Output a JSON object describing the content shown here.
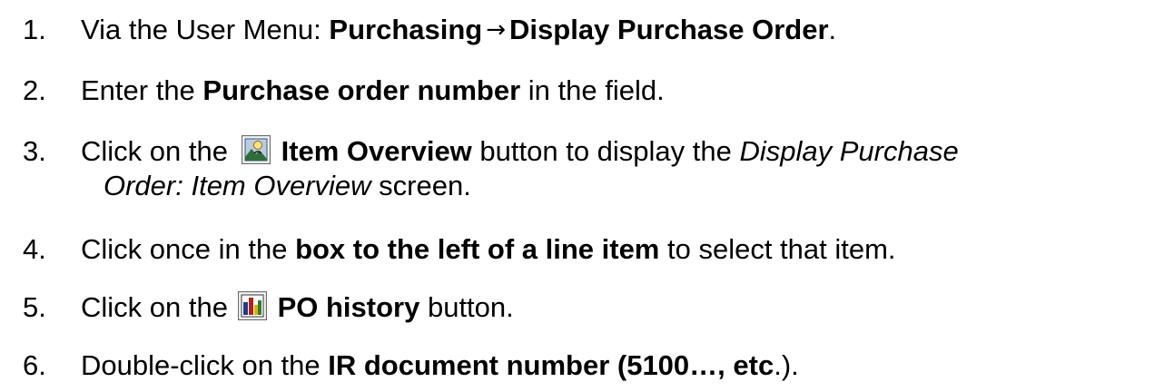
{
  "steps": [
    {
      "number": "1.",
      "parts": [
        "Via the User Menu: ",
        "Purchasing",
        "→",
        "Display Purchase Order",
        "."
      ]
    },
    {
      "number": "2.",
      "parts": [
        "Enter the ",
        "Purchase order number",
        " in the field."
      ]
    },
    {
      "number": "3.",
      "parts": [
        "Click on the ",
        "Item Overview",
        " button to display the ",
        "Display Purchase",
        "Order: Item Overview",
        " screen."
      ],
      "icon": "item-overview-icon"
    },
    {
      "number": "4.",
      "parts": [
        "Click once in the ",
        "box to the left of a line item",
        " to select that item."
      ]
    },
    {
      "number": "5.",
      "parts": [
        "Click on the ",
        "PO history",
        " button."
      ],
      "icon": "po-history-icon"
    },
    {
      "number": "6.",
      "parts": [
        "Double-click on the ",
        "IR document number (5100…, etc",
        ".)."
      ]
    }
  ]
}
